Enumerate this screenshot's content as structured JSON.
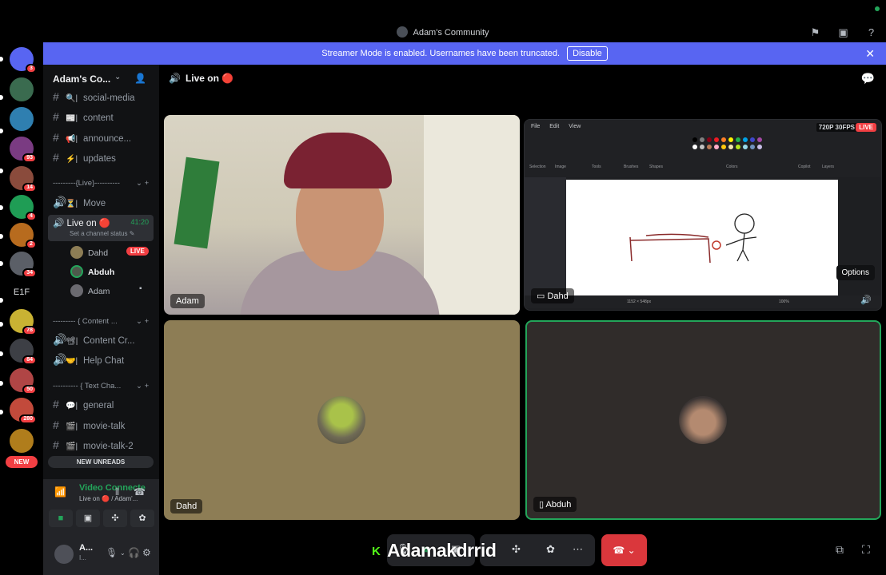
{
  "window": {
    "title": "Adam's Community"
  },
  "banner": {
    "text": "Streamer Mode is enabled. Usernames have been truncated.",
    "disable_label": "Disable",
    "close": "✕"
  },
  "guilds": [
    {
      "name": "discord-home",
      "badge": "3",
      "color": "#5865f2"
    },
    {
      "name": "guild-1",
      "badge": "",
      "color": "#3a6b4f"
    },
    {
      "name": "guild-2",
      "badge": "",
      "color": "#2f7fb0"
    },
    {
      "name": "guild-3",
      "badge": "93",
      "color": "#7a3b82"
    },
    {
      "name": "guild-4",
      "badge": "14",
      "color": "#8a4b3c"
    },
    {
      "name": "guild-5",
      "badge": "4",
      "color": "#1f9d55"
    },
    {
      "name": "guild-6",
      "badge": "2",
      "color": "#b76b1e"
    },
    {
      "name": "guild-7",
      "badge": "34",
      "color": "#5b5f67"
    },
    {
      "name": "guild-8",
      "badge": "78",
      "color": "#c9b233"
    },
    {
      "name": "guild-9",
      "badge": "84",
      "color": "#3d3f45"
    },
    {
      "name": "guild-10",
      "badge": "50",
      "color": "#b04545"
    },
    {
      "name": "guild-11",
      "badge": "280",
      "color": "#c24a3b"
    },
    {
      "name": "guild-12",
      "badge": "",
      "color": "#b07d1c"
    }
  ],
  "guild_text": "E1F",
  "guild_new": "NEW",
  "server": {
    "name": "Adam's Co...",
    "chevron": "⌄",
    "invite": "👤"
  },
  "channels": {
    "social_media": "social-media",
    "content": "content",
    "announce": "announce...",
    "updates": "updates",
    "cat_live": "---------{Live}----------",
    "move": "Move",
    "live_on": "Live on 🔴",
    "live_time": "41:20",
    "set_status": "Set a channel status",
    "cat_content": "--------- { Content ...",
    "content_cr": "Content Cr...",
    "help_chat": "Help Chat",
    "cat_text": "---------- { Text Cha...",
    "general": "general",
    "movie_talk": "movie-talk",
    "movie_talk_2": "movie-talk-2",
    "new_unreads": "NEW UNREADS"
  },
  "voice_users": [
    {
      "name": "Dahd",
      "live": "LIVE"
    },
    {
      "name": "Abduh",
      "live": ""
    },
    {
      "name": "Adam",
      "live": ""
    }
  ],
  "voice_panel": {
    "title": "Video Connecte",
    "subtitle": "Live on 🔴 / Adam'..."
  },
  "user": {
    "name": "A...",
    "status": "I..."
  },
  "stage": {
    "title": "Live on 🔴"
  },
  "tiles": {
    "adam": "Adam",
    "dahd_screen": "Dahd",
    "dahd": "Dahd",
    "abduh": "Abduh",
    "fps": "720P 30FPS",
    "live": "LIVE",
    "options": "Options"
  },
  "paint_menu": [
    "File",
    "Edit",
    "View"
  ],
  "paint_labels": [
    "Selection",
    "Image",
    "Tools",
    "Brushes",
    "Shapes",
    "Colors",
    "Copilot",
    "Layers"
  ],
  "paint_status": [
    "1152 × 548px",
    "100%"
  ],
  "overlay": {
    "name": "Adamakdrrid",
    "k": "K"
  },
  "colors": {
    "accent": "#5865f2",
    "live": "#f23f43",
    "connected": "#23a55a"
  }
}
